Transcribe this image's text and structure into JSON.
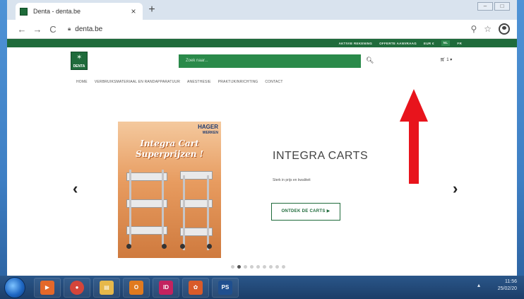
{
  "browser": {
    "tab_title": "Denta - denta.be",
    "tab_close": "×",
    "new_tab": "+",
    "url": "denta.be",
    "icons": [
      "back-icon",
      "forward-icon",
      "reload-icon",
      "lock-icon",
      "zoom-icon",
      "star-icon",
      "profile-icon"
    ]
  },
  "site": {
    "topbar": {
      "account": "AKTIVIE REKENING",
      "quote": "OFFERTE AANVRAAG",
      "currency": "EUR €",
      "lang_nl": "NL",
      "lang_fr": "FR"
    },
    "logo": "DENTA",
    "search_placeholder": "Zoek naar...",
    "cart_label": "1",
    "menu": [
      "HOME",
      "VERBRUIKSMATERIAAL EN RANDAPPARATUUR",
      "ANESTHESIE",
      "PRAKTIJKINRICHTING",
      "CONTACT"
    ],
    "slide": {
      "promo_brand": "HAGER",
      "promo_brand_sub": "WERKEN",
      "promo_headline_1": "Integra Cart",
      "promo_headline_2": "Superprijzen !",
      "title": "INTEGRA CARTS",
      "subtitle": "Sterk in prijs en kwaliteit",
      "cta": "ONTDEK DE CARTS ▶",
      "prev": "‹",
      "next": "›",
      "dots": 9,
      "active_dot": 2
    }
  },
  "taskbar": {
    "apps": [
      {
        "name": "media-player-icon",
        "label": "▶",
        "color": "#e4682a"
      },
      {
        "name": "chrome-icon",
        "label": "●",
        "color": "#d4453a"
      },
      {
        "name": "explorer-icon",
        "label": "▤",
        "color": "#e6b84a"
      },
      {
        "name": "outlook-icon",
        "label": "O",
        "color": "#e07a1f"
      },
      {
        "name": "indesign-icon",
        "label": "ID",
        "color": "#c3235f"
      },
      {
        "name": "paint-icon",
        "label": "✿",
        "color": "#d95b2a"
      },
      {
        "name": "photoshop-icon",
        "label": "PS",
        "color": "#1f4f8f"
      }
    ],
    "time": "11:56",
    "date": "25/02/20"
  },
  "colors": {
    "brand_green": "#1f6b3b",
    "annotation_red": "#e8141c"
  }
}
